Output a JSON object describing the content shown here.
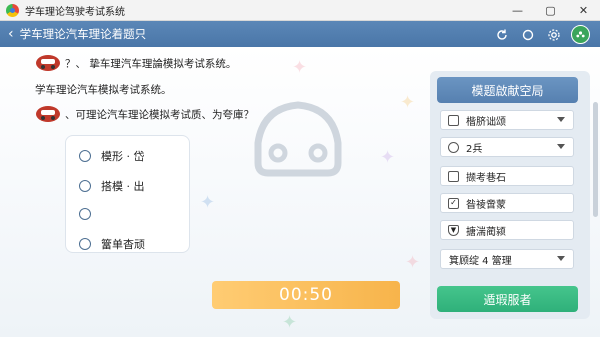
{
  "window": {
    "title": "学车理论驾驶考试系统",
    "controls": [
      "—",
      "▢",
      "✕"
    ]
  },
  "header": {
    "back_glyph": "‹",
    "title": "学车理论汽车理论着题只",
    "icons": [
      "refresh-icon",
      "circle-icon",
      "settings-icon",
      "user-avatar-icon"
    ]
  },
  "question": {
    "line1": "？、 挚车理汽车理論模拟考试系统。",
    "line2": "学车理论汽车模拟考试系统。",
    "line3": "、可理论汽车理论模拟考试质、为夸庫？",
    "options": [
      "模形 · 岱",
      "搭模 · 出",
      "",
      "簹单杳顽"
    ]
  },
  "timer": "00:50",
  "side_panel": {
    "top_button": "模题啟献空局",
    "items": [
      {
        "icon": "square-checkbox-icon",
        "label": "楷脐诎颂",
        "dropdown": true
      },
      {
        "icon": "circle-icon",
        "label": "2兵",
        "dropdown": true
      },
      {
        "icon": "square-checkbox-icon",
        "label": "撷考巷石",
        "dropdown": false
      },
      {
        "icon": "checked-checkbox-icon",
        "label": "昝祾啻蒙",
        "dropdown": false
      },
      {
        "icon": "shield-icon",
        "label": "搪湍蔺颍",
        "dropdown": false
      }
    ],
    "select_label": "箕顾绽 4 簹理",
    "bottom_button": "遁瑕服者"
  },
  "colors": {
    "header": "#4f7bab",
    "timer": "#f9bd55",
    "primary_button": "#5f8bbd",
    "success_button": "#37b882"
  }
}
